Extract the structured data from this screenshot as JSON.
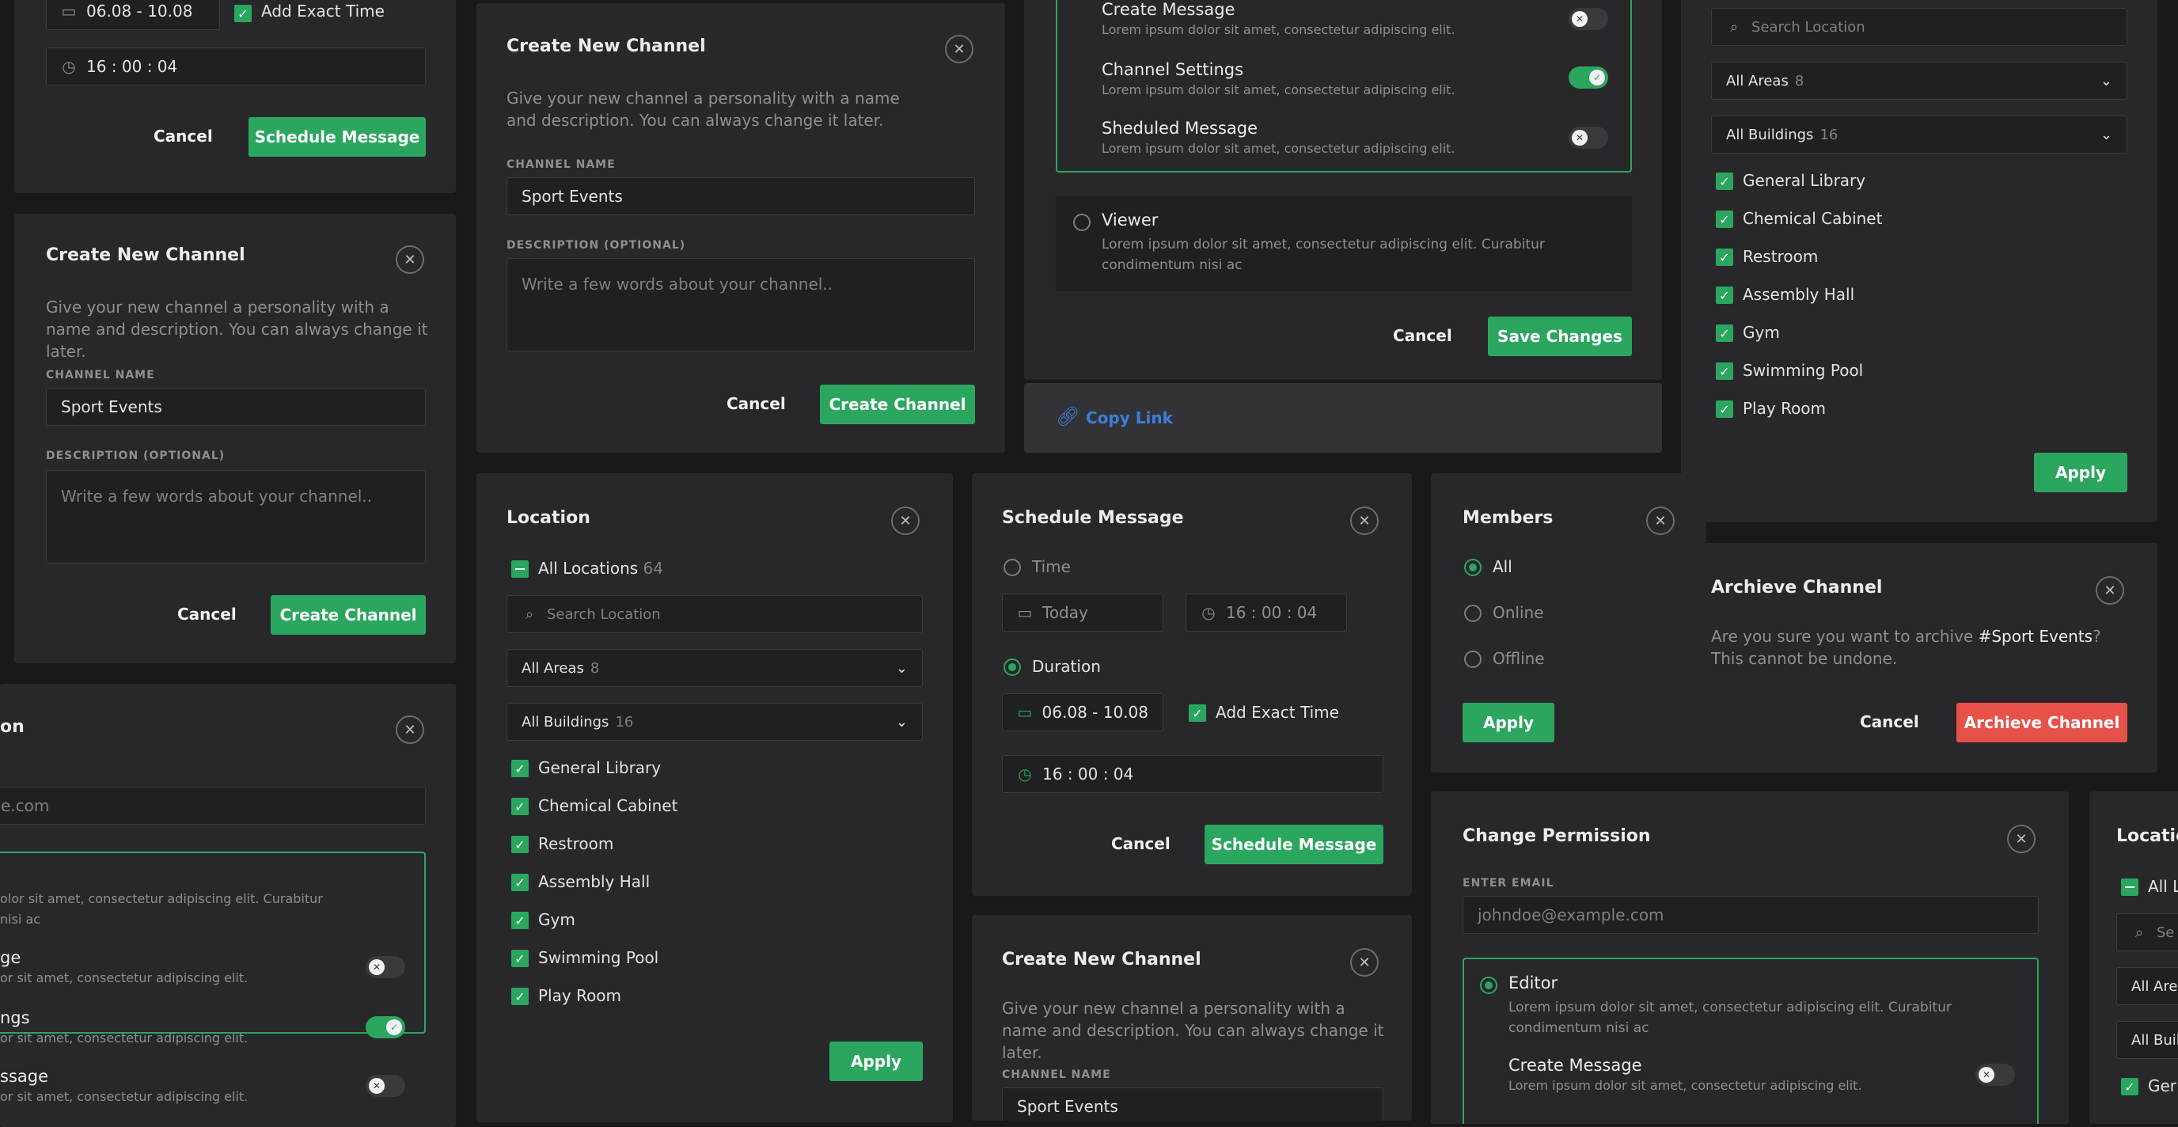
{
  "colors": {
    "background": "#19191b",
    "card": "#28282b",
    "accent": "#2ba65f",
    "danger": "#e6514a",
    "link": "#3b7fd9"
  },
  "common": {
    "cancel": "Cancel",
    "close_icon": "close-icon",
    "apply": "Apply"
  },
  "create_channel": {
    "title": "Create New Channel",
    "description": "Give your new channel a personality with a name and description. You can always change it later.",
    "channel_name_label": "CHANNEL NAME",
    "channel_name_value": "Sport Events",
    "description_label": "DESCRIPTION (OPTIONAL)",
    "description_placeholder": "Write a few words about your channel..",
    "submit": "Create Channel"
  },
  "schedule": {
    "title": "Schedule Message",
    "time_label": "Time",
    "date_today": "Today",
    "time_value": "16 : 00 : 04",
    "duration_label": "Duration",
    "date_range": "06.08 - 10.08",
    "add_exact_time": "Add Exact Time",
    "exact_time": "16 : 00 : 04",
    "submit": "Schedule Message"
  },
  "location": {
    "title": "Location",
    "all_locations": "All Locations",
    "all_locations_count": "64",
    "search_placeholder": "Search Location",
    "areas_label": "All Areas",
    "areas_count": "8",
    "buildings_label": "All Buildings",
    "buildings_count": "16",
    "items": [
      "General Library",
      "Chemical Cabinet",
      "Restroom",
      "Assembly Hall",
      "Gym",
      "Swimming Pool",
      "Play Room"
    ],
    "apply": "Apply"
  },
  "permissions": {
    "title": "Change Permission",
    "email_label": "ENTER EMAIL",
    "email_placeholder": "johndoe@example.com",
    "editor": "Editor",
    "viewer": "Viewer",
    "role_desc": "Lorem ipsum dolor sit amet, consectetur adipiscing elit. Curabitur condimentum nisi ac",
    "opt_desc": "Lorem ipsum dolor sit amet, consectetur adipiscing elit.",
    "create_message": "Create Message",
    "channel_settings": "Channel Settings",
    "scheduled_message": "Sheduled Message",
    "save": "Save Changes",
    "copy_link": "Copy Link"
  },
  "members": {
    "title": "Members",
    "options": [
      "All",
      "Online",
      "Offline"
    ],
    "apply": "Apply"
  },
  "archive": {
    "title": "Archieve Channel",
    "text_before": "Are you sure you want to archive ",
    "channel": "#Sport Events",
    "text_after": "? This cannot be undone.",
    "submit": "Archieve Channel"
  },
  "left_partial": {
    "title_fragment": "on",
    "email_fragment": "e.com",
    "desc_fragment_1": "olor sit amet, consectetur adipiscing elit. Curabitur",
    "desc_fragment_2": "nisi ac",
    "create_fragment": "ge",
    "settings_fragment": "ngs",
    "scheduled_fragment": "ssage",
    "opt_fragment": "or sit amet, consectetur adipiscing elit."
  },
  "right_partial": {
    "title_fragment": "Locatio",
    "all_fragment": "All L",
    "search_fragment": "Se",
    "areas_fragment": "All Are",
    "buildings_fragment": "All Buil",
    "item_fragment": "Ger"
  }
}
